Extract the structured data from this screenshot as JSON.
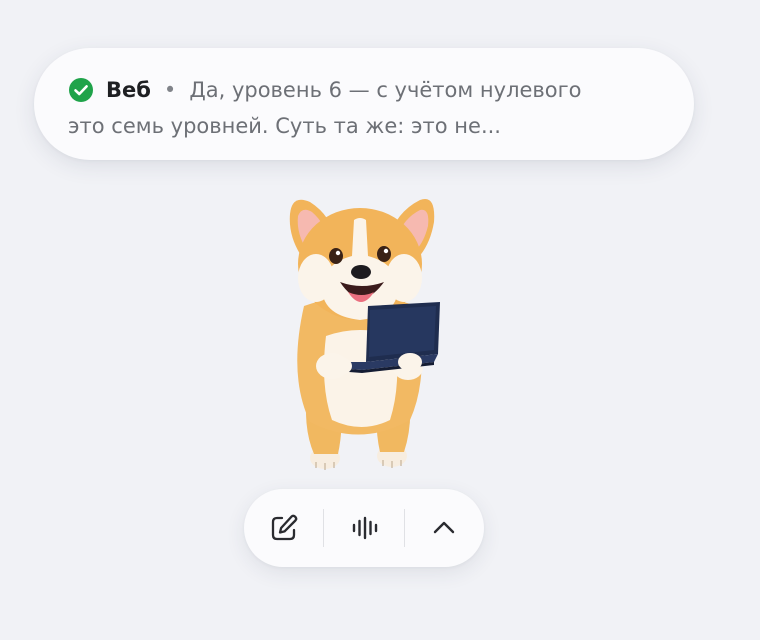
{
  "notification": {
    "status_icon": "check-circle-icon",
    "status_color": "#1fa34a",
    "source": "Веб",
    "separator": "•",
    "line1_text": "Да, уровень 6 — с учётом нулевого",
    "line2_text": "это семь уровней. Суть та же: это не..."
  },
  "mascot": {
    "description_icon": "corgi-with-laptop-illustration"
  },
  "toolbar": {
    "buttons": [
      {
        "icon": "edit-icon"
      },
      {
        "icon": "voice-waveform-icon"
      },
      {
        "icon": "chevron-up-icon"
      }
    ]
  }
}
